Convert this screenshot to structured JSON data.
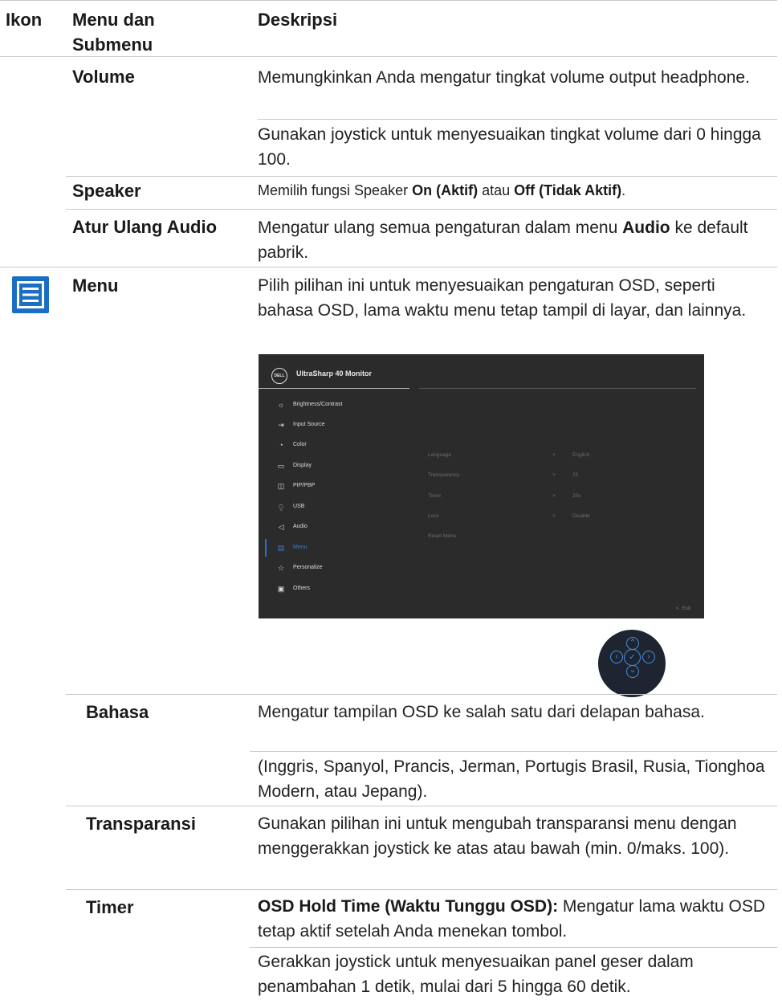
{
  "header": {
    "col_icon": "Ikon",
    "col_menu_1": "Menu dan",
    "col_menu_2": "Submenu",
    "col_desc": "Deskripsi"
  },
  "rows": {
    "volume": {
      "name": "Volume",
      "desc_1": "Memungkinkan Anda mengatur tingkat volume output headphone.",
      "desc_2": "Gunakan joystick untuk menyesuaikan tingkat volume dari 0 hingga 100."
    },
    "speaker": {
      "name": "Speaker",
      "desc_a": "Memilih fungsi Speaker ",
      "desc_b": "On (Aktif)",
      "desc_c": " atau ",
      "desc_d": "Off (Tidak Aktif)",
      "desc_e": "."
    },
    "reset_audio": {
      "name": "Atur Ulang Audio",
      "desc_a": "Mengatur ulang semua pengaturan dalam menu ",
      "desc_b": "Audio",
      "desc_c": " ke default pabrik."
    },
    "menu": {
      "name": "Menu",
      "icon": "menu-list-icon",
      "desc": "Pilih pilihan ini untuk menyesuaikan pengaturan OSD, seperti bahasa OSD, lama waktu menu tetap tampil di layar, dan lainnya."
    },
    "bahasa": {
      "name": "Bahasa",
      "desc_1": "Mengatur tampilan OSD ke salah satu dari delapan bahasa.",
      "desc_2": "(Inggris, Spanyol, Prancis, Jerman, Portugis Brasil, Rusia, Tionghoa Modern, atau Jepang)."
    },
    "transparansi": {
      "name": "Transparansi",
      "desc": "Gunakan pilihan ini untuk mengubah transparansi menu dengan menggerakkan joystick ke atas atau bawah (min. 0/maks. 100)."
    },
    "timer": {
      "name": "Timer",
      "desc_a": "OSD Hold Time (Waktu Tunggu OSD):",
      "desc_b": " Mengatur lama waktu OSD tetap aktif setelah Anda menekan tombol.",
      "desc_2": "Gerakkan joystick untuk menyesuaikan panel geser dalam penambahan 1 detik, mulai dari 5 hingga 60 detik."
    }
  },
  "osd": {
    "logo": "DELL",
    "title": "UltraSharp 40 Monitor",
    "menu_items": [
      {
        "label": "Brightness/Contrast",
        "icon": "sun-icon"
      },
      {
        "label": "Input Source",
        "icon": "input-icon"
      },
      {
        "label": "Color",
        "icon": "palette-icon"
      },
      {
        "label": "Display",
        "icon": "display-icon"
      },
      {
        "label": "PIP/PBP",
        "icon": "pip-icon"
      },
      {
        "label": "USB",
        "icon": "usb-icon"
      },
      {
        "label": "Audio",
        "icon": "speaker-icon"
      },
      {
        "label": "Menu",
        "icon": "menu-icon"
      },
      {
        "label": "Personalize",
        "icon": "star-icon"
      },
      {
        "label": "Others",
        "icon": "others-icon"
      }
    ],
    "selected": "Menu",
    "settings": [
      {
        "name": "Language",
        "arrow": ">",
        "value": "English"
      },
      {
        "name": "Transparency",
        "arrow": ">",
        "value": "20"
      },
      {
        "name": "Timer",
        "arrow": ">",
        "value": "20s"
      },
      {
        "name": "Lock",
        "arrow": ">",
        "value": "Disable"
      },
      {
        "name": "Reset Menu",
        "arrow": "",
        "value": ""
      }
    ],
    "exit": "Exit",
    "exit_icon": "<"
  },
  "joystick": {
    "icon": "joystick-icon"
  }
}
